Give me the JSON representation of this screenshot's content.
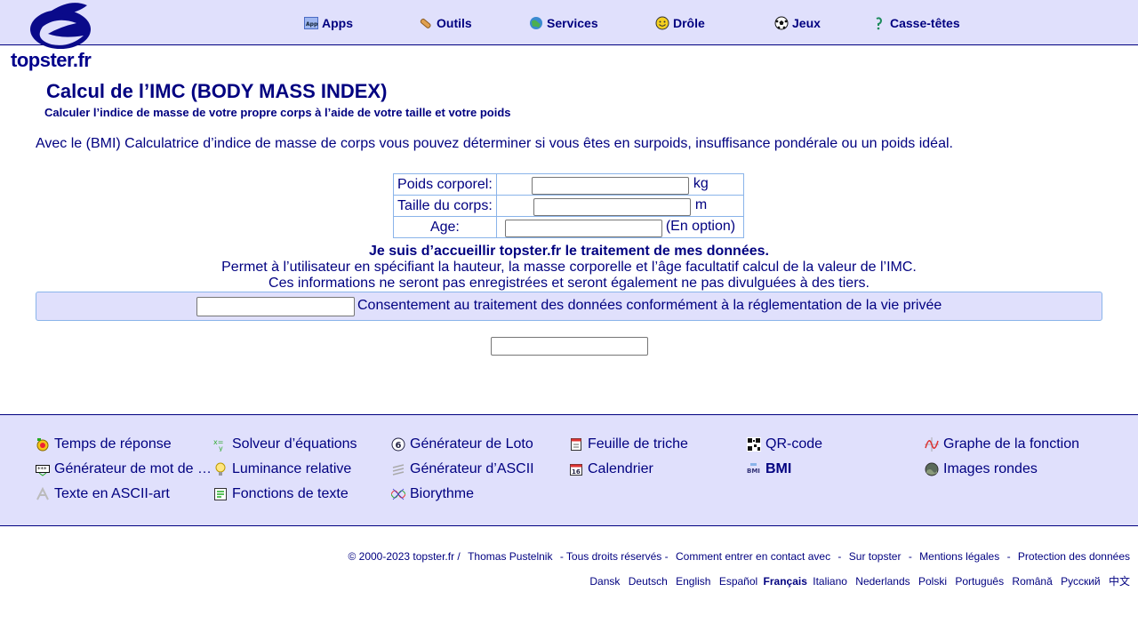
{
  "header": {
    "logo_text": "topster.fr",
    "nav": [
      {
        "label": "Apps",
        "icon": "apps-icon"
      },
      {
        "label": "Outils",
        "icon": "tools-icon"
      },
      {
        "label": "Services",
        "icon": "globe-icon"
      },
      {
        "label": "Drôle",
        "icon": "smiley-icon"
      },
      {
        "label": "Jeux",
        "icon": "soccer-ball-icon"
      },
      {
        "label": "Casse-têtes",
        "icon": "puzzle-icon"
      }
    ]
  },
  "main": {
    "title": "Calcul de l’IMC (BODY MASS INDEX)",
    "subtitle": "Calculer l’indice de masse de votre propre corps à l’aide de votre taille et votre poids",
    "intro": "Avec le (BMI) Calculatrice d’indice de masse de corps vous pouvez déterminer si vous êtes en surpoids, insuffisance pondérale ou un poids idéal.",
    "form": {
      "weight_label": "Poids corporel:",
      "weight_value": "",
      "weight_unit": "kg",
      "height_label": "Taille du corps:",
      "height_value": "",
      "height_unit": "m",
      "age_label": "Age:",
      "age_value": "",
      "age_unit": "(En option)"
    },
    "consent": {
      "bold": "Je suis d’accueillir topster.fr le traitement de mes données.",
      "line1": "Permet à l’utilisateur en spécifiant la hauteur, la masse corporelle et l’âge facultatif calcul de la valeur de l’IMC.",
      "line2": "Ces informations ne seront pas enregistrées et seront également ne pas divulguées à des tiers.",
      "checkbox_label": "Consentement au traitement des données conformément à la réglementation de la vie privée",
      "checkbox_value": ""
    },
    "submit_value": ""
  },
  "apps": [
    [
      {
        "label": "Temps de réponse",
        "icon": "stopwatch-icon"
      },
      {
        "label": "Générateur de mot de …",
        "icon": "password-icon"
      },
      {
        "label": "Texte en ASCII-art",
        "icon": "ascii-art-icon"
      }
    ],
    [
      {
        "label": "Solveur d’équations",
        "icon": "equation-icon"
      },
      {
        "label": "Luminance relative",
        "icon": "lightbulb-icon"
      },
      {
        "label": "Fonctions de texte",
        "icon": "text-functions-icon"
      }
    ],
    [
      {
        "label": "Générateur de Loto",
        "icon": "lotto-ball-icon"
      },
      {
        "label": "Générateur d’ASCII",
        "icon": "ascii-icon"
      },
      {
        "label": "Biorythme",
        "icon": "biorhythm-icon"
      }
    ],
    [
      {
        "label": "Feuille de triche",
        "icon": "cheat-sheet-icon"
      },
      {
        "label": "Calendrier",
        "icon": "calendar-icon"
      }
    ],
    [
      {
        "label": "QR-code",
        "icon": "qr-code-icon"
      },
      {
        "label": "BMI",
        "icon": "bmi-icon",
        "current": true
      }
    ],
    [
      {
        "label": "Graphe de la fonction",
        "icon": "function-graph-icon"
      },
      {
        "label": "Images rondes",
        "icon": "round-image-icon"
      }
    ]
  ],
  "footer": {
    "copyright": "© 2000-2023 topster.fr /",
    "links": [
      "Thomas Pustelnik",
      "- Tous droits réservés -",
      "Comment entrer en contact avec",
      "-",
      "Sur topster",
      "-",
      "Mentions légales",
      "-",
      "Protection des données"
    ],
    "languages": [
      "Dansk",
      "Deutsch",
      "English",
      "Español",
      "Français",
      "Italiano",
      "Nederlands",
      "Polski",
      "Português",
      "Română",
      "Русский",
      "中文"
    ],
    "current_language": "Français"
  },
  "colors": {
    "header_bg": "#e0e0fc",
    "text": "#000080",
    "border": "#8ab4ea"
  }
}
